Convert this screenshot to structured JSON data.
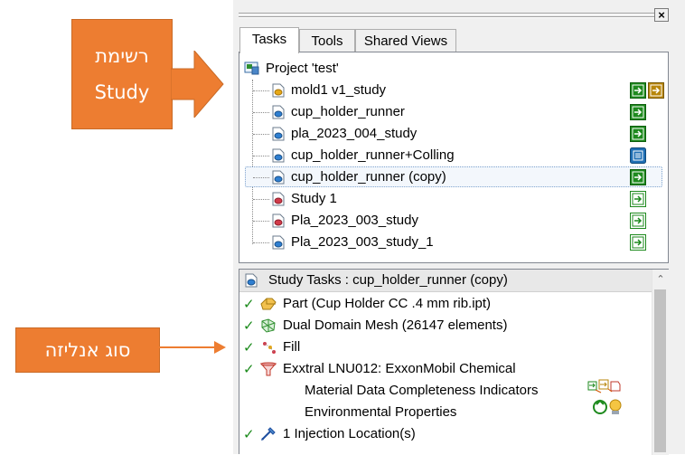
{
  "callouts": {
    "study_list": {
      "line1": "רשימת",
      "line2": "Study"
    },
    "analysis_type": {
      "text": "סוג אנליזה"
    }
  },
  "window": {
    "close_label": "×"
  },
  "tabs": [
    {
      "label": "Tasks",
      "active": true
    },
    {
      "label": "Tools",
      "active": false
    },
    {
      "label": "Shared Views",
      "active": false
    }
  ],
  "project": {
    "label": "Project 'test'"
  },
  "studies": [
    {
      "label": "mold1 v1_study",
      "icon": "mold-study-icon",
      "status": [
        "launch-green-icon",
        "launch-orange-icon"
      ]
    },
    {
      "label": "cup_holder_runner",
      "icon": "study-blue-icon",
      "status": [
        "launch-green-icon"
      ]
    },
    {
      "label": "pla_2023_004_study",
      "icon": "study-blue-icon",
      "status": [
        "launch-green-icon"
      ]
    },
    {
      "label": "cup_holder_runner+Colling",
      "icon": "study-blue-icon",
      "status": [
        "queue-blue-icon"
      ]
    },
    {
      "label": "cup_holder_runner (copy)",
      "icon": "study-blue-icon",
      "status": [
        "launch-green-icon"
      ],
      "selected": true
    },
    {
      "label": "Study 1",
      "icon": "study-red-icon",
      "status": [
        "launch-outline-green-icon"
      ]
    },
    {
      "label": "Pla_2023_003_study",
      "icon": "study-red-icon",
      "status": [
        "launch-outline-green-icon"
      ]
    },
    {
      "label": "Pla_2023_003_study_1",
      "icon": "study-blue-icon",
      "status": [
        "launch-outline-green-icon"
      ]
    }
  ],
  "study_tasks": {
    "header": "Study Tasks : cup_holder_runner (copy)",
    "items": [
      {
        "label": "Part (Cup Holder CC .4 mm rib.ipt)",
        "icon": "part-icon",
        "checked": true
      },
      {
        "label": "Dual Domain Mesh (26147 elements)",
        "icon": "mesh-icon",
        "checked": true
      },
      {
        "label": "Fill",
        "icon": "fill-analysis-icon",
        "checked": true
      },
      {
        "label": "Exxtral LNU012: ExxonMobil Chemical",
        "icon": "material-funnel-icon",
        "checked": true
      },
      {
        "label": "Material Data Completeness Indicators",
        "icon": "",
        "checked": false
      },
      {
        "label": "Environmental Properties",
        "icon": "",
        "checked": false
      },
      {
        "label": "1 Injection Location(s)",
        "icon": "injection-icon",
        "checked": true
      }
    ]
  },
  "scroll": {
    "up_glyph": "⌃"
  },
  "colors": {
    "callout": "#ed7d31",
    "launch_green": "#1e8a1e",
    "queue_blue": "#1f6fb4",
    "orange_status": "#b8860b"
  }
}
